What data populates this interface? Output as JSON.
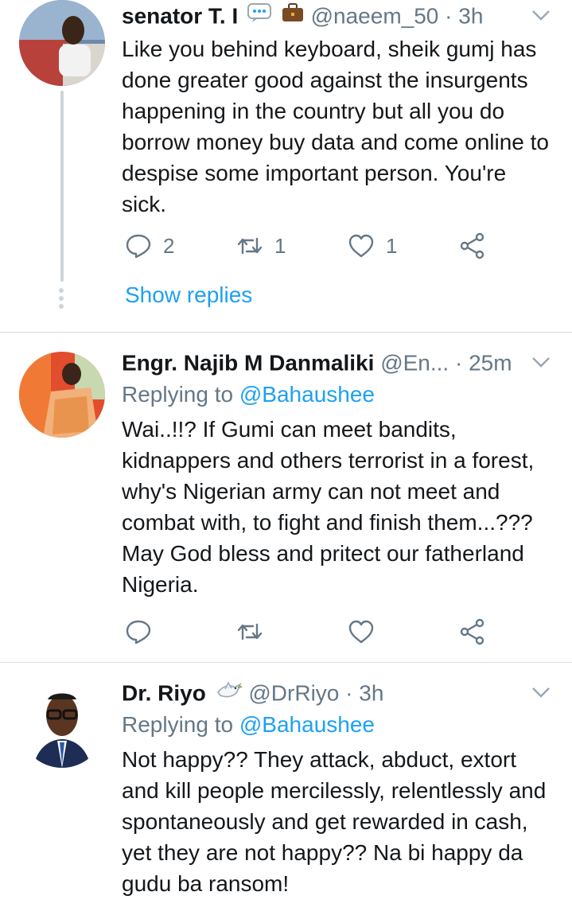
{
  "tweets": [
    {
      "name": "senator T. I",
      "emoji_badges": [
        "speech-bubble-emoji",
        "briefcase-emoji"
      ],
      "handle": "@naeem_50",
      "time": "· 3h",
      "body": "Like you behind keyboard, sheik gumj has done greater good against the insurgents happening in the country but all you do borrow money buy data and come online to despise some important person. You're sick.",
      "replies": "2",
      "retweets": "1",
      "likes": "1",
      "show_replies": "Show replies"
    },
    {
      "name": "Engr. Najib M Danmaliki",
      "handle": "@En...",
      "time": "· 25m",
      "replying_prefix": "Replying to",
      "replying_to": "@Bahaushee",
      "body": "Wai..!!? If Gumi can meet bandits, kidnappers and others terrorist in a forest, why's Nigerian army can not meet and combat with, to fight and finish them...??? May God bless and pritect our fatherland Nigeria."
    },
    {
      "name": "Dr. Riyo",
      "emoji_badges": [
        "dove-emoji"
      ],
      "handle": "@DrRiyo",
      "time": "· 3h",
      "replying_prefix": "Replying to",
      "replying_to": "@Bahaushee",
      "body": "Not happy?? They attack, abduct, extort and kill people mercilessly, relentlessly and spontaneously and get rewarded in cash, yet they are not happy?? Na bi happy da gudu ba ransom!"
    }
  ],
  "colors": {
    "accent": "#1da1f2",
    "muted": "#657786",
    "text": "#14171a",
    "divider": "#d8dde1"
  }
}
